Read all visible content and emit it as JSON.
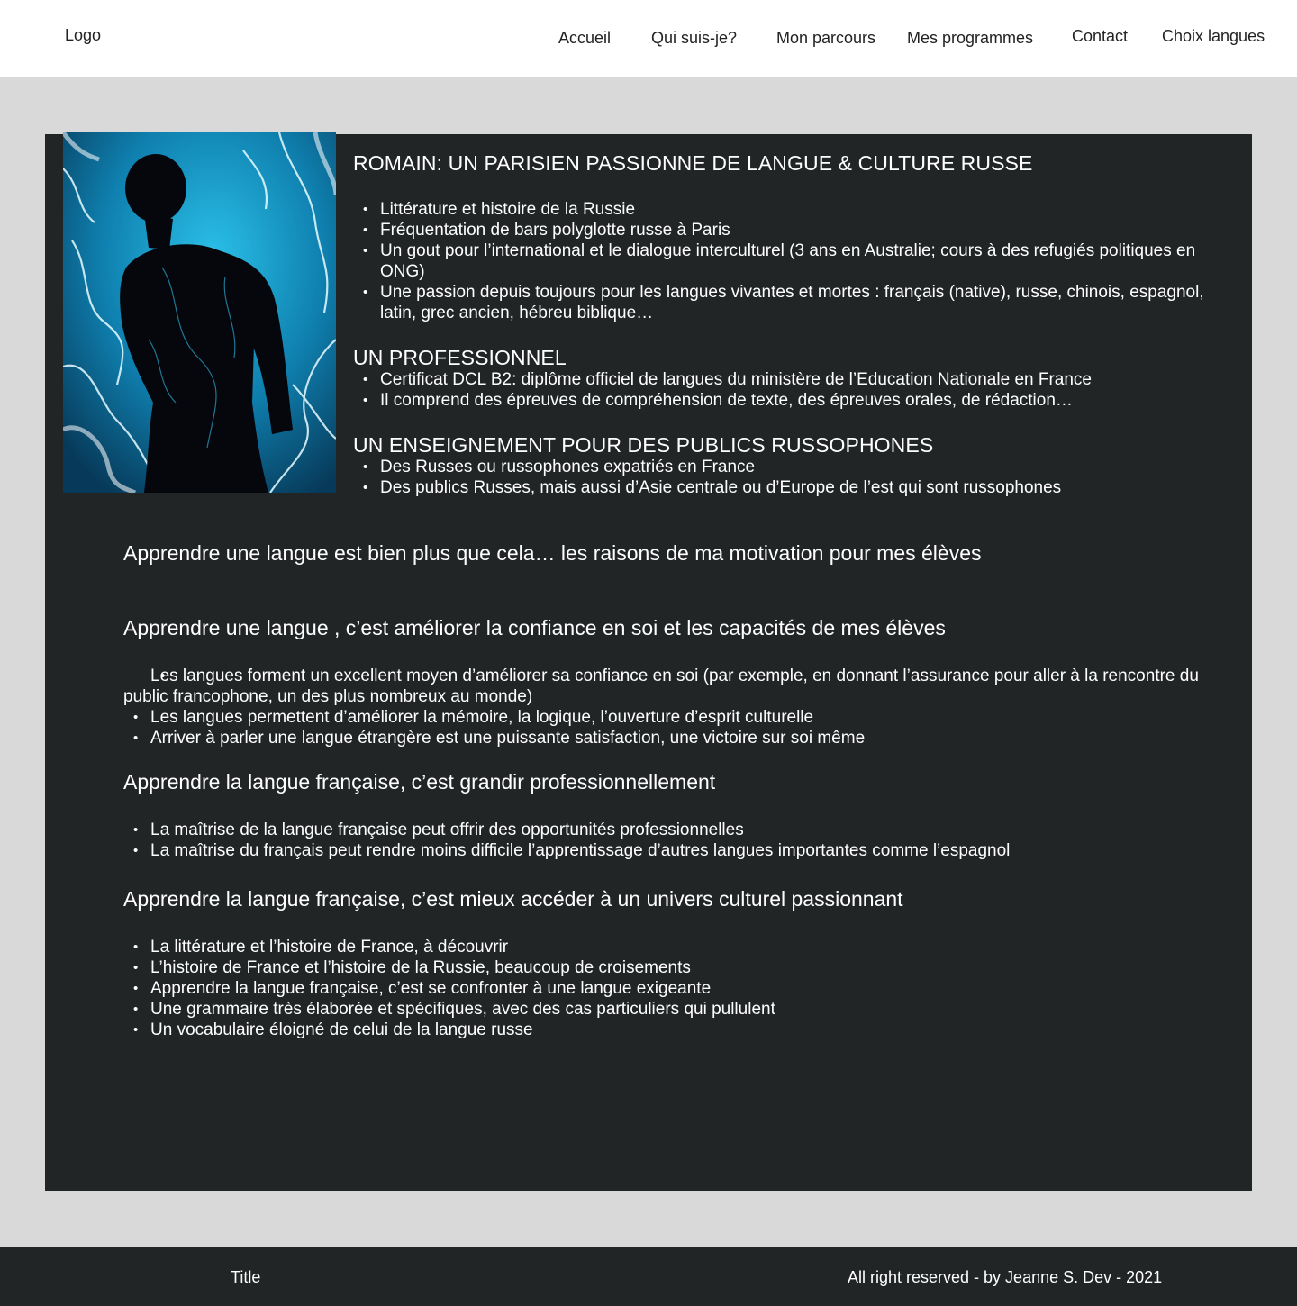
{
  "header": {
    "logo": "Logo",
    "nav": [
      {
        "label": "Accueil"
      },
      {
        "label": "Qui suis-je?"
      },
      {
        "label": "Mon parcours"
      },
      {
        "label": "Mes programmes"
      },
      {
        "label": "Contact"
      },
      {
        "label": "Choix langues"
      }
    ]
  },
  "profile": {
    "heading": "ROMAIN: UN PARISIEN PASSIONNE DE LANGUE & CULTURE RUSSE",
    "items": [
      "Littérature et histoire de la Russie",
      "Fréquentation de bars polyglotte russe à Paris",
      "Un gout pour l’international et le dialogue interculturel (3 ans en Australie; cours à des refugiés politiques en ONG)",
      "Une passion depuis toujours pour les langues vivantes et mortes : français (native), russe, chinois, espagnol, latin, grec ancien, hébreu biblique…"
    ]
  },
  "professional": {
    "heading": "UN PROFESSIONNEL",
    "items": [
      "Certificat DCL B2: diplôme officiel de langues du ministère de l’Education Nationale en France",
      "Il comprend des épreuves de compréhension de texte, des épreuves orales, de rédaction…"
    ]
  },
  "teaching": {
    "heading": "UN ENSEIGNEMENT POUR  DES PUBLICS RUSSOPHONES",
    "items": [
      "Des Russes ou russophones expatriés en France",
      "Des publics Russes, mais aussi d’Asie centrale ou d’Europe de l’est qui sont russophones"
    ]
  },
  "motivation": {
    "intro": "Apprendre une langue est bien plus que cela… les raisons de ma motivation pour mes élèves",
    "sections": [
      {
        "heading": "Apprendre une langue , c’est améliorer la confiance en soi et les capacités de mes élèves",
        "items": [
          "Les langues forment un excellent moyen d’améliorer sa confiance en soi (par exemple, en donnant l’assurance pour aller à la rencontre du public francophone, un des plus nombreux au monde)",
          "Les langues permettent d’améliorer la mémoire, la logique, l’ouverture d’esprit culturelle",
          "Arriver à parler une langue étrangère est une puissante satisfaction, une victoire sur soi même"
        ]
      },
      {
        "heading": "Apprendre la langue française, c’est grandir professionnellement",
        "items": [
          "La maîtrise de la langue française peut offrir des opportunités professionnelles",
          "La maîtrise du français peut rendre moins difficile l’apprentissage d’autres langues importantes comme l’espagnol"
        ]
      },
      {
        "heading": "Apprendre la langue française, c’est mieux accéder à un univers culturel passionnant",
        "items": [
          "La littérature et l’histoire de France, à découvrir",
          "L’histoire de France et l’histoire de la Russie, beaucoup de croisements",
          "Apprendre la langue française, c’est se confronter à une langue exigeante",
          "Une grammaire très élaborée et spécifiques, avec des cas particuliers qui pullulent",
          "Un vocabulaire éloigné de celui de la langue russe"
        ]
      }
    ]
  },
  "footer": {
    "title": "Title",
    "copyright": "All right reserved - by Jeanne S. Dev - 2021"
  },
  "colors": {
    "panel_bg": "#222526",
    "page_bg": "#d9d9d9",
    "header_bg": "#ffffff",
    "photo_accent": "#1fa9d6"
  }
}
